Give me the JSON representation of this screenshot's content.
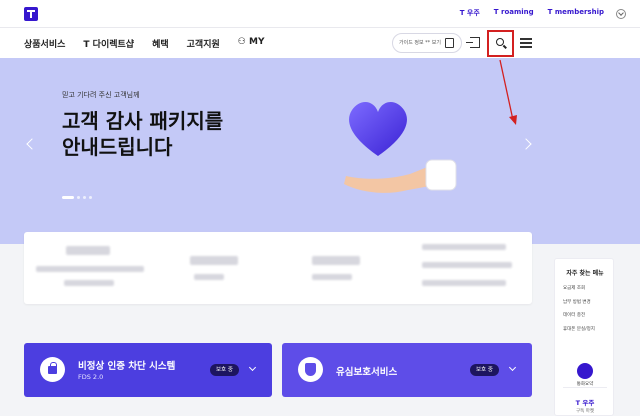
{
  "topbar": {
    "links": [
      "T 우주",
      "T roaming",
      "T membership"
    ]
  },
  "nav": {
    "items": [
      "상품서비스",
      "T 다이렉트샵",
      "혜택",
      "고객지원",
      "⚇ MY"
    ],
    "search_pill_text": "가이드 정보 ** 보기"
  },
  "hero": {
    "subtitle": "믿고 기다려 주신 고객님께",
    "title": "고객 감사 패키지를\n안내드립니다",
    "slide_index": 1
  },
  "quick_menu": {
    "title": "자주 찾는 메뉴",
    "items": [
      "요금제 조회",
      "납부 방법 변경",
      "데이터 충전",
      "휴대폰 분실/정지"
    ],
    "badge_label": "통화요약",
    "t_universe": "T 우주",
    "t_universe_sub": "구독 마켓"
  },
  "cards": [
    {
      "title": "비정상 인증 차단 시스템",
      "subtitle": "FDS 2.0",
      "badge": "보호 중"
    },
    {
      "title": "유심보호서비스",
      "badge": "보호 중"
    }
  ],
  "colors": {
    "brand": "#3617ce",
    "hero_bg": "#c4c9f7",
    "card_left": "#4c3ee0",
    "card_right": "#5e4de8",
    "highlight_box": "#d32020"
  }
}
